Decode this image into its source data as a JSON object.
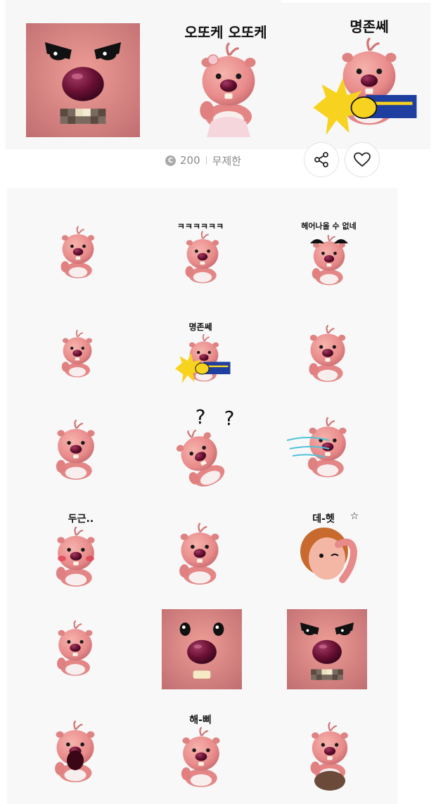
{
  "header": {
    "captions": [
      "오또케 오또케",
      "명존쎄"
    ],
    "price": "200",
    "price_coin_letter": "C",
    "duration": "무제한"
  },
  "grid": {
    "captions": [
      "ㅋㅋㅋㅋㅋㅋ",
      "헤어나올 수 없네",
      "명존쎄",
      "두근..",
      "데-헷",
      "해-삐"
    ],
    "question_marks": [
      "?",
      "?"
    ],
    "star": "☆"
  },
  "colors": {
    "beaver_pink": "#e88a8a",
    "beaver_light": "#f2a9a5",
    "nose": "#6a1033",
    "belly": "#f8eeee",
    "accent_yellow": "#f7d21e",
    "accent_blue": "#1f3fa0",
    "hair": "#c86a2e"
  },
  "icons": [
    "share-icon",
    "heart-icon",
    "coin-icon"
  ]
}
